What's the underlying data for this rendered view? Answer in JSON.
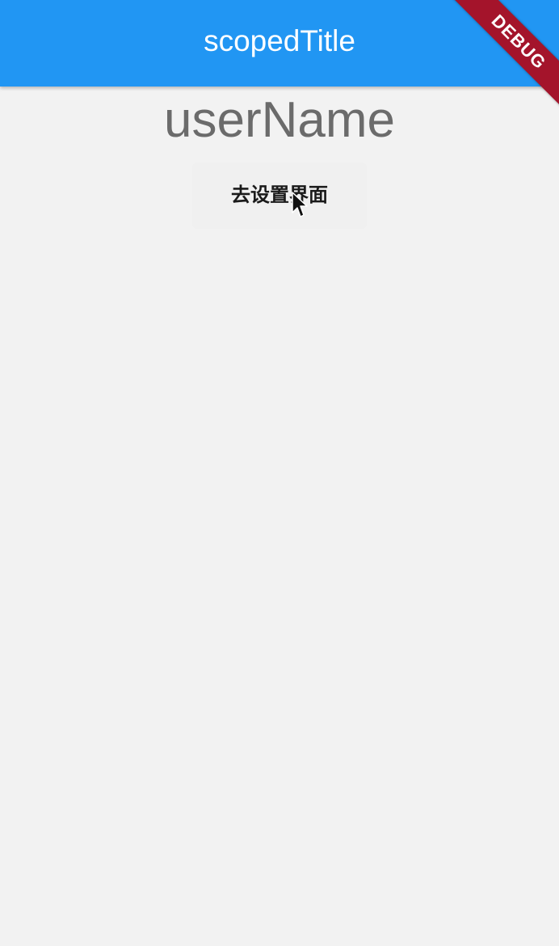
{
  "app_bar": {
    "title": "scopedTitle",
    "color": "#2196f3"
  },
  "debug_banner": {
    "label": "DEBUG",
    "color": "#a4142b"
  },
  "main": {
    "user_name": "userName",
    "settings_button_label": "去设置界面"
  },
  "icons": {
    "cursor": "mouse-pointer-icon"
  }
}
